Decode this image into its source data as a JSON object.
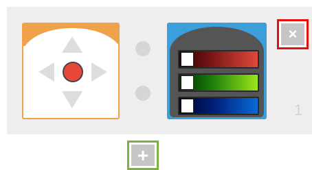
{
  "blocks": [
    {
      "name": "direction-pad-block",
      "icon": "dpad-icon",
      "accent": "#f0a24a"
    },
    {
      "name": "color-slider-block",
      "icon": "rgb-sliders-icon",
      "accent": "#3b9fdb",
      "sliders": [
        {
          "channel": "red",
          "color": "#e0483a"
        },
        {
          "channel": "green",
          "color": "#9be61a"
        },
        {
          "channel": "blue",
          "color": "#0a6ad6"
        }
      ]
    }
  ],
  "controls": {
    "close_symbol": "×",
    "close_border_color": "#e01010",
    "add_symbol": "+",
    "add_border_color": "#7ab140"
  },
  "slot_number": "1",
  "colors": {
    "panel_background": "#eeeeee",
    "dpad_center": "#e8483a",
    "arrow": "#dddddd"
  }
}
